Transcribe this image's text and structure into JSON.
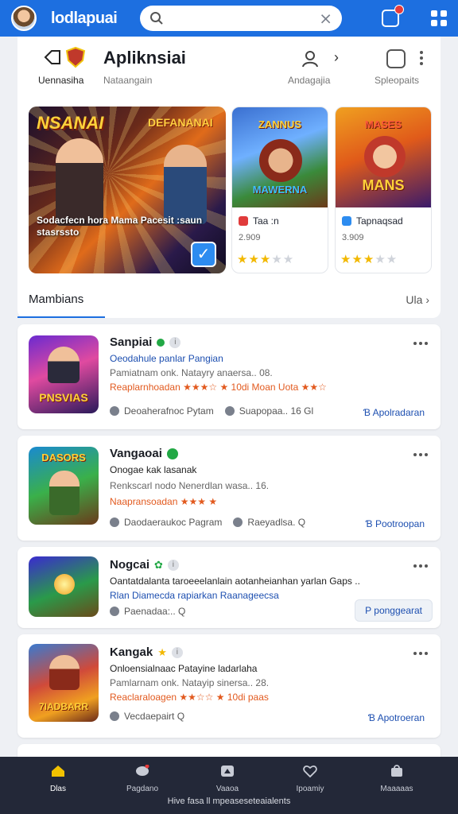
{
  "topbar": {
    "app_name": "lodlapuai",
    "search_placeholder": "",
    "clear_label": "⨯"
  },
  "header": {
    "title": "Apliknsiai",
    "sub_left": "Uennasiha",
    "sub_mid": "Nataangain",
    "sub_right1": "Andagajia",
    "sub_right2": "Spleopaits"
  },
  "banner": {
    "logo_left": "NSANAI",
    "logo_right": "DEFANANAI",
    "caption": "Sodacfecn hora Mama Pacesit :saun stasrssto"
  },
  "featured_cards": [
    {
      "art_title_top": "ZANNUS",
      "art_title_bottom": "MAWERNA",
      "name": "Taa :n",
      "size": "2.909",
      "rating": 3,
      "icon_color": "#e03b3b"
    },
    {
      "art_title_top": "MASES",
      "art_title_bottom": "MANS",
      "name": "Tapnaqsad",
      "size": "3.909",
      "rating": 3,
      "icon_color": "#2d8cf0"
    }
  ],
  "section": {
    "title": "Mambians",
    "more": "Ula"
  },
  "apps": [
    {
      "title": "Sanpiai",
      "line1": "Oeodahule panlar Pangian",
      "line2": "Pamiatnam onk. Natayry anaersa.. 08.",
      "line3": "Reaplarnhoadan ★★★☆ ★ 10di Moan Uota ★★☆",
      "meta1": "Deoaherafnoc Pytam",
      "meta2": "Suapopaa.. 16 Gl",
      "cta": "Ɓ Apolradaran",
      "thumb_text": "PNSVIAS"
    },
    {
      "title": "Vangaoai",
      "line1": "Onogae kak lasanak",
      "line2": "Renkscarl nodo Nenerdlan wasa.. 16.",
      "line3": "Naapransoadan ★★★ ★",
      "meta1": "Daodaeraukoc Pagram",
      "meta2": "Raeyadlsa. Q",
      "cta": "Ɓ Pootroopan",
      "thumb_text": "DASORS"
    },
    {
      "title": "Nogcai",
      "line1": "Oantatdalanta taroeeelanlain aotanheianhan yarlan Gaps ..",
      "line2": "Rlan Diamecda rapiarkan Raanageecsa",
      "line3": "",
      "meta1": "Paenadaa:.. Q",
      "meta2": "",
      "cta": "P ponggearat",
      "thumb_text": ""
    },
    {
      "title": "Kangak",
      "line1": "Onloensialnaac Patayine ladarlaha",
      "line2": "Pamlarnam onk. Natayip sinersa.. 28.",
      "line3": "Reaclaraloagen ★★☆☆ ★ 10di paas",
      "meta1": "Vecdaepairt Q",
      "meta2": "",
      "cta": "Ɓ Apotroeran",
      "thumb_text": "7IADBARR"
    }
  ],
  "bottom_nav": {
    "items": [
      "Dlas",
      "Pagdano",
      "Vaaoa",
      "Ipoamiy",
      "Maaaaas"
    ],
    "active_index": 0,
    "footer": "Hive fasa ll mpeaseseteaialents"
  }
}
